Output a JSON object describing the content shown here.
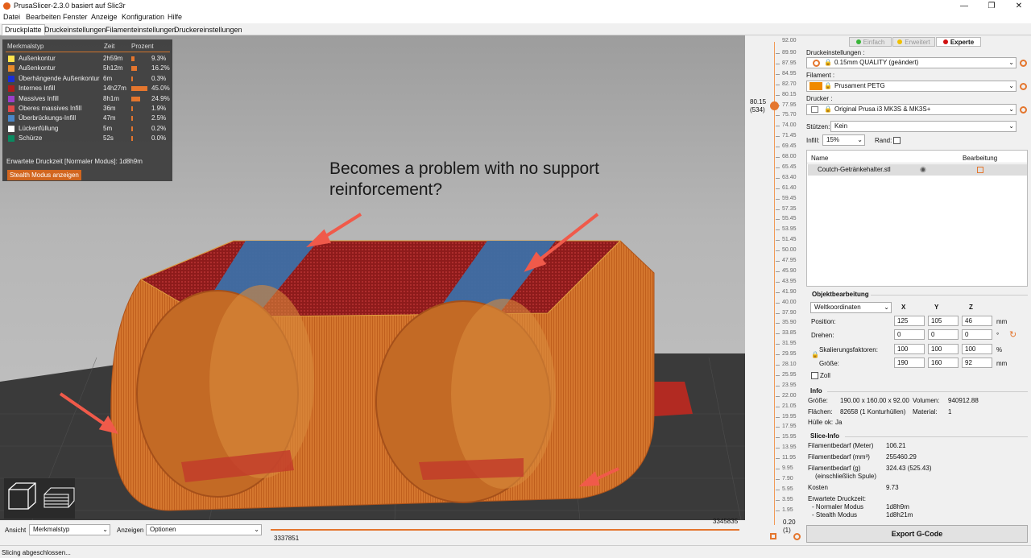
{
  "window": {
    "title": "PrusaSlicer-2.3.0 basiert auf Slic3r"
  },
  "menu": [
    "Datei",
    "Bearbeiten",
    "Fenster",
    "Anzeige",
    "Konfiguration",
    "Hilfe"
  ],
  "tabs": [
    "Druckplatte",
    "Druckeinstellungen",
    "Filamenteinstellungen",
    "Druckereinstellungen"
  ],
  "legend": {
    "headers": {
      "type": "Merkmalstyp",
      "time": "Zeit",
      "percent": "Prozent"
    },
    "rows": [
      {
        "color": "#ffe34d",
        "name": "Außenkontur",
        "time": "2h59m",
        "pct": "9.3%",
        "frac": 0.093
      },
      {
        "color": "#e88a2a",
        "name": "Außenkontur",
        "time": "5h12m",
        "pct": "16.2%",
        "frac": 0.162
      },
      {
        "color": "#1a2ed6",
        "name": "Überhängende Außenkontur",
        "time": "6m",
        "pct": "0.3%",
        "frac": 0.003
      },
      {
        "color": "#b01c1c",
        "name": "Internes Infill",
        "time": "14h27m",
        "pct": "45.0%",
        "frac": 0.45
      },
      {
        "color": "#9a3fc9",
        "name": "Massives Infill",
        "time": "8h1m",
        "pct": "24.9%",
        "frac": 0.249
      },
      {
        "color": "#e04a4a",
        "name": "Oberes massives Infill",
        "time": "36m",
        "pct": "1.9%",
        "frac": 0.019
      },
      {
        "color": "#4a86c8",
        "name": "Überbrückungs-Infill",
        "time": "47m",
        "pct": "2.5%",
        "frac": 0.025
      },
      {
        "color": "#ffffff",
        "name": "Lückenfüllung",
        "time": "5m",
        "pct": "0.2%",
        "frac": 0.002
      },
      {
        "color": "#0a8a60",
        "name": "Schürze",
        "time": "52s",
        "pct": "0.0%",
        "frac": 0.0
      }
    ],
    "eta_label": "Erwartete Druckzeit [Normaler Modus]:",
    "eta_value": "1d8h9m",
    "stealth_button": "Stealth Modus anzeigen"
  },
  "annotation": {
    "line1": "Becomes a problem with no support",
    "line2": "reinforcement?"
  },
  "vslider": {
    "top_value": "92.00",
    "current": "80.15",
    "current_layer": "(534)",
    "bottom_value": "0.20",
    "bottom_layer": "(1)",
    "ticks": [
      "89.90",
      "87.95",
      "84.95",
      "82.70",
      "80.15",
      "77.95",
      "75.70",
      "74.00",
      "71.45",
      "69.45",
      "68.00",
      "65.45",
      "63.40",
      "61.40",
      "59.45",
      "57.35",
      "55.45",
      "53.95",
      "51.45",
      "50.00",
      "47.95",
      "45.90",
      "43.95",
      "41.90",
      "40.00",
      "37.90",
      "35.90",
      "33.85",
      "31.95",
      "29.95",
      "28.10",
      "25.95",
      "23.95",
      "22.00",
      "21.05",
      "19.95",
      "17.95",
      "15.95",
      "13.95",
      "11.95",
      "9.95",
      "7.90",
      "5.95",
      "3.95",
      "1.95"
    ]
  },
  "bottom": {
    "view_label": "Ansicht",
    "view_value": "Merkmalstyp",
    "show_label": "Anzeigen",
    "show_value": "Optionen",
    "h_left": "3337851",
    "h_right": "3345835"
  },
  "status": "Slicing abgeschlossen...",
  "right": {
    "modes": [
      {
        "label": "Einfach",
        "color": "#3ab53a"
      },
      {
        "label": "Erweitert",
        "color": "#f0c000"
      },
      {
        "label": "Experte",
        "color": "#d01010"
      }
    ],
    "print_settings_label": "Druckeinstellungen :",
    "print_settings_value": "0.15mm QUALITY (geändert)",
    "filament_label": "Filament :",
    "filament_value": "Prusament PETG",
    "filament_color": "#f08a00",
    "printer_label": "Drucker :",
    "printer_value": "Original Prusa i3 MK3S & MK3S+",
    "supports_label": "Stützen:",
    "supports_value": "Kein",
    "infill_label": "Infill:",
    "infill_value": "15%",
    "brim_label": "Rand:",
    "list_headers": {
      "name": "Name",
      "edit": "Bearbeitung"
    },
    "object_name": "Coutch-Getränkehalter.stl",
    "obj_edit_title": "Objektbearbeitung",
    "coord_system": "Weltkoordinaten",
    "axes": [
      "X",
      "Y",
      "Z"
    ],
    "position_label": "Position:",
    "position": [
      "125",
      "105",
      "46"
    ],
    "position_unit": "mm",
    "rotate_label": "Drehen:",
    "rotate": [
      "0",
      "0",
      "0"
    ],
    "rotate_unit": "°",
    "scale_label": "Skalierungsfaktoren:",
    "scale": [
      "100",
      "100",
      "100"
    ],
    "scale_unit": "%",
    "size_label": "Größe:",
    "size": [
      "190",
      "160",
      "92"
    ],
    "size_unit": "mm",
    "inch_label": "Zoll",
    "info_title": "Info",
    "info": {
      "size_label": "Größe:",
      "size_value": "190.00 x 160.00 x 92.00",
      "volume_label": "Volumen:",
      "volume_value": "940912.88",
      "faces_label": "Flächen:",
      "faces_value": "82658 (1 Konturhüllen)",
      "material_label": "Material:",
      "material_value": "1",
      "hull_label": "Hülle ok:",
      "hull_value": "Ja"
    },
    "slice_title": "Slice-Info",
    "slice": [
      {
        "label": "Filamentbedarf (Meter)",
        "value": "106.21"
      },
      {
        "label": "Filamentbedarf (mm³)",
        "value": "255460.29"
      },
      {
        "label": "Filamentbedarf (g)",
        "label2": "(einschließlich Spule)",
        "value": "324.43 (525.43)"
      },
      {
        "label": "Kosten",
        "value": "9.73"
      }
    ],
    "eta_title": "Erwartete Druckzeit:",
    "eta_normal_label": "- Normaler Modus",
    "eta_normal": "1d8h9m",
    "eta_stealth_label": "- Stealth Modus",
    "eta_stealth": "1d8h21m",
    "export_label": "Export G-Code"
  }
}
